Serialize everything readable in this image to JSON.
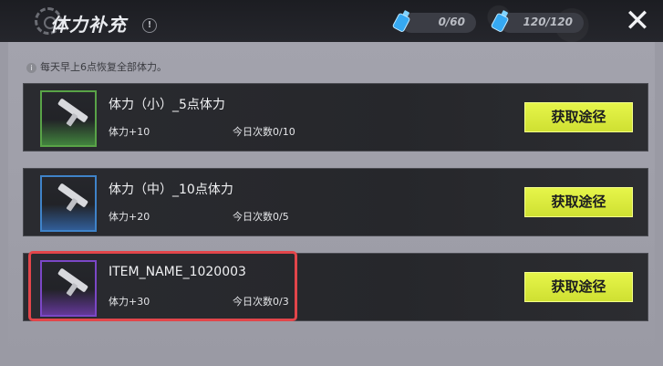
{
  "header": {
    "title": "体力补充",
    "info_symbol": "!",
    "resources": [
      {
        "icon": "stamina-bottle-icon",
        "value": "0/60"
      },
      {
        "icon": "stamina-bottle-icon",
        "value": "120/120"
      }
    ],
    "close_symbol": "✕"
  },
  "notice": {
    "icon_symbol": "i",
    "text": "每天早上6点恢复全部体力。"
  },
  "items": [
    {
      "name": "体力（小）_5点体力",
      "bonus": "体力+10",
      "count": "今日次数0/10",
      "button": "获取途径",
      "rarity_color": "#59a347"
    },
    {
      "name": "体力（中）_10点体力",
      "bonus": "体力+20",
      "count": "今日次数0/5",
      "button": "获取途径",
      "rarity_color": "#3f83c9"
    },
    {
      "name": "ITEM_NAME_1020003",
      "bonus": "体力+30",
      "count": "今日次数0/3",
      "button": "获取途径",
      "rarity_color": "#7b47c6"
    }
  ],
  "highlight_color": "#e2454a"
}
